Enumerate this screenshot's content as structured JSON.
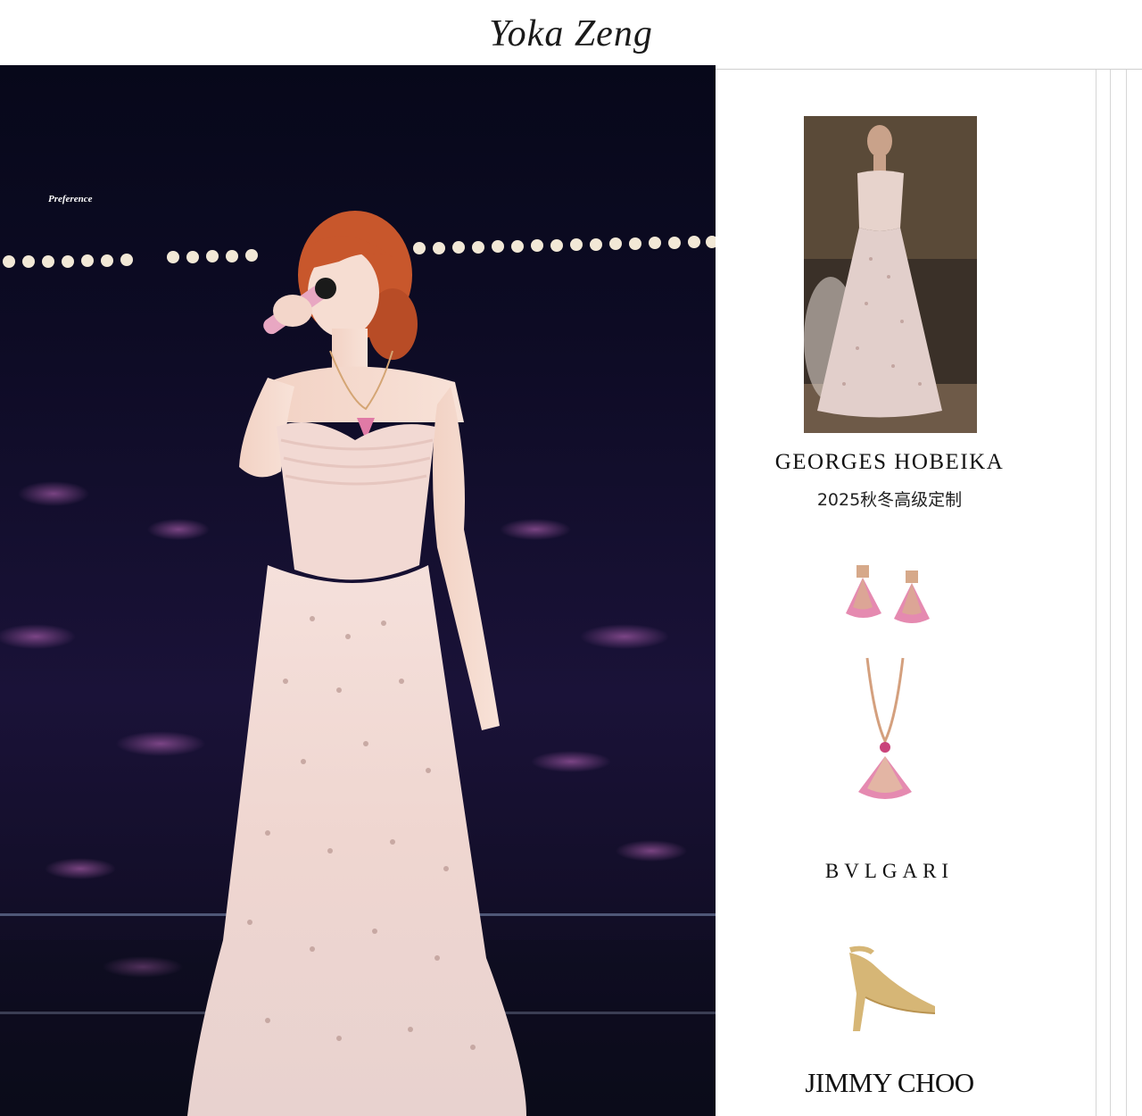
{
  "header": {
    "title": "Yoka  Zeng"
  },
  "main_photo": {
    "watermark": "Preference"
  },
  "outfit": {
    "dress_brand": "GEORGES  HOBEIKA",
    "dress_collection": "2025秋冬高级定制",
    "jewelry_brand": "BVLGARI",
    "shoe_brand": "JIMMY CHOO"
  },
  "colors": {
    "stage_background": "#0d0b1e",
    "dress_pink": "#f3dcd8",
    "hair": "#c8572c",
    "gold": "#d6b676"
  }
}
